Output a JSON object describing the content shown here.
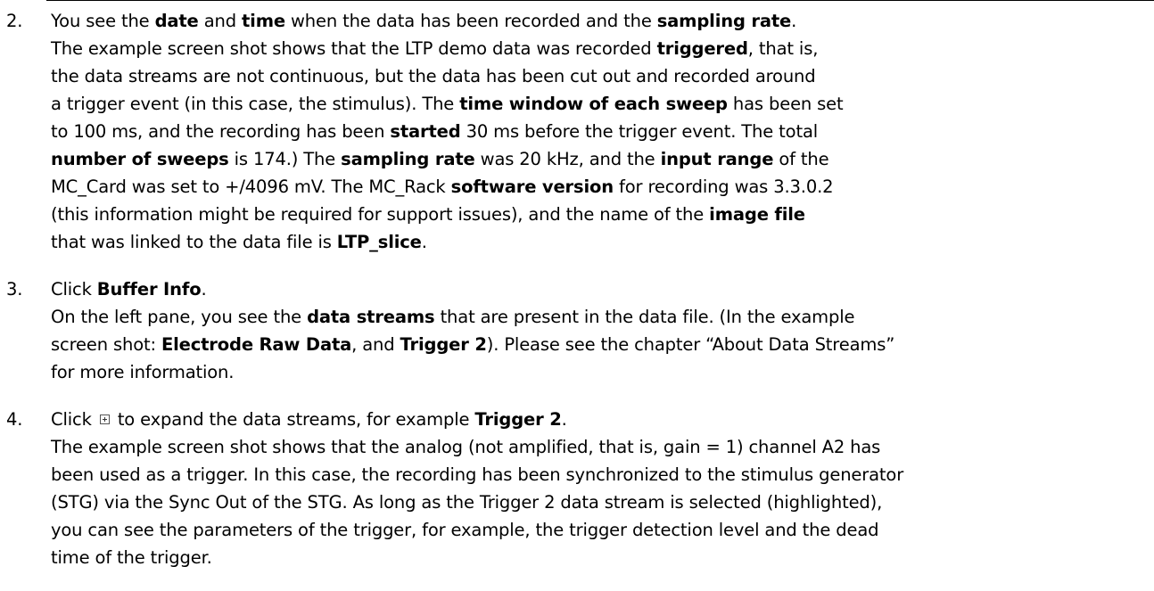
{
  "items": [
    {
      "number": "2.",
      "lines": [
        [
          {
            "t": "You see the ",
            "b": false
          },
          {
            "t": "date",
            "b": true
          },
          {
            "t": " and ",
            "b": false
          },
          {
            "t": "time",
            "b": true
          },
          {
            "t": " when the data has been recorded and the ",
            "b": false
          },
          {
            "t": "sampling rate",
            "b": true
          },
          {
            "t": ".",
            "b": false
          }
        ],
        [
          {
            "t": "The example screen shot shows that the LTP demo data was recorded ",
            "b": false
          },
          {
            "t": "triggered",
            "b": true
          },
          {
            "t": ", that is,",
            "b": false
          }
        ],
        [
          {
            "t": "the data streams are not continuous, but the data has been cut out and recorded around",
            "b": false
          }
        ],
        [
          {
            "t": "a trigger event (in this case, the stimulus). The ",
            "b": false
          },
          {
            "t": "time window of each sweep",
            "b": true
          },
          {
            "t": " has been set",
            "b": false
          }
        ],
        [
          {
            "t": "to 100 ms, and the recording has been ",
            "b": false
          },
          {
            "t": "started",
            "b": true
          },
          {
            "t": " 30 ms before the trigger event. The total",
            "b": false
          }
        ],
        [
          {
            "t": "number of sweeps",
            "b": true
          },
          {
            "t": " is 174.) The ",
            "b": false
          },
          {
            "t": "sampling rate",
            "b": true
          },
          {
            "t": " was 20 kHz, and the ",
            "b": false
          },
          {
            "t": "input range",
            "b": true
          },
          {
            "t": " of the",
            "b": false
          }
        ],
        [
          {
            "t": "MC_Card was set to +/4096 mV. The MC_Rack ",
            "b": false
          },
          {
            "t": "software version",
            "b": true
          },
          {
            "t": " for recording was 3.3.0.2",
            "b": false
          }
        ],
        [
          {
            "t": "(this information might be required for support issues), and the name of the ",
            "b": false
          },
          {
            "t": "image file",
            "b": true
          }
        ],
        [
          {
            "t": "that was linked to the data file is ",
            "b": false
          },
          {
            "t": "LTP_slice",
            "b": true
          },
          {
            "t": ".",
            "b": false
          }
        ]
      ]
    },
    {
      "number": "3.",
      "lines": [
        [
          {
            "t": "Click ",
            "b": false
          },
          {
            "t": "Buffer Info",
            "b": true
          },
          {
            "t": ".",
            "b": false
          }
        ],
        [
          {
            "t": "On the left pane, you see the ",
            "b": false
          },
          {
            "t": "data streams",
            "b": true
          },
          {
            "t": "  that are present in the data file. (In the example",
            "b": false
          }
        ],
        [
          {
            "t": "screen shot: ",
            "b": false
          },
          {
            "t": "Electrode Raw Data",
            "b": true
          },
          {
            "t": ", and ",
            "b": false
          },
          {
            "t": "Trigger 2",
            "b": true
          },
          {
            "t": "). Please see the chapter “About Data Streams”",
            "b": false
          }
        ],
        [
          {
            "t": "for more information.",
            "b": false
          }
        ]
      ]
    },
    {
      "number": "4.",
      "lines": [
        [
          {
            "t": "Click ",
            "b": false
          },
          {
            "icon": "expand-plus-icon"
          },
          {
            "t": " to expand the data streams, for example ",
            "b": false
          },
          {
            "t": "Trigger 2",
            "b": true
          },
          {
            "t": ".",
            "b": false
          }
        ],
        [
          {
            "t": "The example screen shot shows that the analog (not amplified, that is, gain = 1) channel A2 has",
            "b": false
          }
        ],
        [
          {
            "t": "been used as a trigger. In this case, the recording has been synchronized to the stimulus generator",
            "b": false
          }
        ],
        [
          {
            "t": "(STG) via the Sync Out of the STG. As long as the Trigger 2 data stream is selected (highlighted),",
            "b": false
          }
        ],
        [
          {
            "t": "you can see the parameters of the trigger, for example, the trigger detection level and the dead",
            "b": false
          }
        ],
        [
          {
            "t": "time of the trigger.",
            "b": false
          }
        ]
      ]
    }
  ]
}
